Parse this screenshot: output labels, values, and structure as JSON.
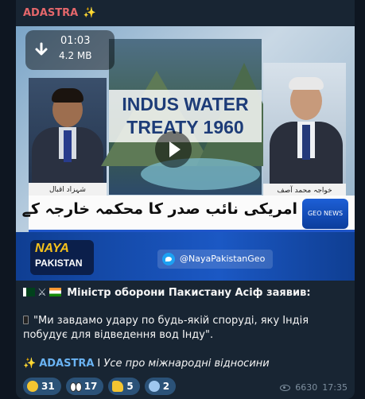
{
  "channel": {
    "name": "ADASTRA",
    "spark": "✨"
  },
  "video": {
    "duration": "01:03",
    "size": "4.2 MB",
    "frame": {
      "title_line1": "INDUS WATER",
      "title_line2": "TREATY 1960",
      "left_name": "شہزاد اقبال",
      "right_name": "خواجہ محمد آصف",
      "ticker_text": "امریکی نائب صدر کا محکمہ خارجہ کے موقف کے برعکس بیان",
      "ticker_logo": "GEO NEWS",
      "show_logo_line1": "NAYA",
      "show_logo_line2": "PAKISTAN",
      "social_handle": "@NayaPakistanGeo"
    }
  },
  "message": {
    "headline": "Міністр оборони Пакистану Асіф заявив:",
    "quote": "\"Ми завдамо удару по будь-якій споруді, яку Індія побудує для відведення вод Інду\".",
    "signature_name": "ADASTRA",
    "signature_sep": "I",
    "signature_tag": "Усе про міжнародні відносини"
  },
  "reactions": [
    {
      "icon": "laugh-emoji-icon",
      "count": "31"
    },
    {
      "icon": "eyes-emoji-icon",
      "count": "17"
    },
    {
      "icon": "thumbs-up-emoji-icon",
      "count": "5"
    },
    {
      "icon": "scream-emoji-icon",
      "count": "2"
    }
  ],
  "views": "6630",
  "time": "17:35",
  "colors": {
    "bubble": "#182533",
    "background": "#0e1621",
    "channel_name": "#e4676b",
    "link": "#6ab3f3",
    "reaction_bg": "#2b5278"
  }
}
